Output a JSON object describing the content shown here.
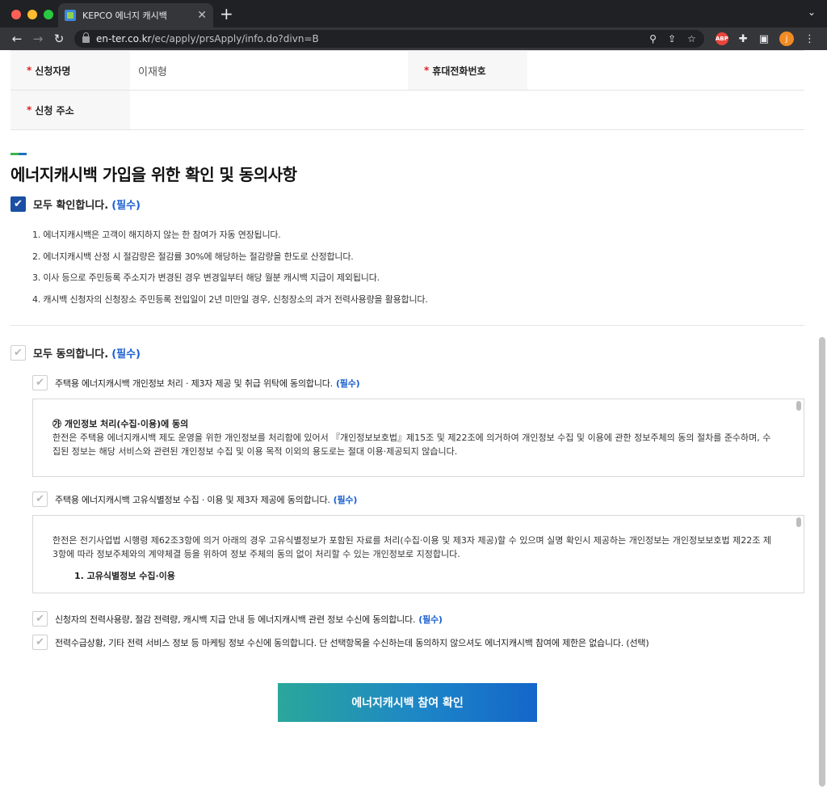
{
  "browser": {
    "tab_title": "KEPCO 에너지 캐시백",
    "tab_close": "✕",
    "new_tab": "+",
    "url_host": "en-ter.co.kr",
    "url_path": "/ec/apply/prsApply/info.do?divn=B",
    "back": "←",
    "forward": "→",
    "reload": "↻",
    "abp_label": "ABP",
    "avatar_letter": "j",
    "tab_menu": "⌄"
  },
  "applicant": {
    "name_label": "신청자명",
    "name_value": "이재형",
    "phone_label": "휴대전화번호",
    "phone_value": "",
    "address_label": "신청 주소",
    "address_value": "",
    "required_mark": "*"
  },
  "section": {
    "title": "에너지캐시백 가입을 위한 확인 및 동의사항"
  },
  "confirm_all": {
    "label": "모두 확인합니다.",
    "tag": "(필수)",
    "checked": true
  },
  "notices": [
    "1. 에너지캐시백은 고객이 해지하지 않는 한 참여가 자동 연장됩니다.",
    "2. 에너지캐시백 산정 시 절감량은 절감률 30%에 해당하는 절감량을 한도로 산정합니다.",
    "3. 이사 등으로 주민등록 주소지가 변경된 경우 변경일부터 해당 월분 캐시백 지급이 제외됩니다.",
    "4. 캐시백 신청자의 신청장소 주민등록 전입일이 2년 미만일 경우, 신청장소의 과거 전력사용량을 활용합니다."
  ],
  "agree_all": {
    "label": "모두 동의합니다.",
    "tag": "(필수)",
    "checked": false
  },
  "consents": [
    {
      "label": "주택용 에너지캐시백 개인정보 처리 · 제3자 제공 및 취급 위탁에 동의합니다.",
      "tag": "(필수)",
      "box_heading": "㉮ 개인정보 처리(수집·이용)에 동의",
      "box_text": "한전은 주택용 에너지캐시백 제도 운영을 위한 개인정보를 처리함에 있어서 『개인정보보호법』제15조 및 제22조에 의거하여 개인정보 수집 및 이용에 관한 정보주체의 동의 절차를 준수하며, 수집된 정보는 해당 서비스와 관련된 개인정보 수집 및 이용 목적 이외의 용도로는 절대 이용·제공되지 않습니다."
    },
    {
      "label": "주택용 에너지캐시백 고유식별정보 수집 · 이용 및 제3자 제공에 동의합니다.",
      "tag": "(필수)",
      "box_text": "한전은 전기사업법 시행령 제62조3항에 의거 아래의 경우 고유식별정보가 포함된 자료를 처리(수집·이용 및 제3자 제공)할 수 있으며 실명 확인시 제공하는 개인정보는 개인정보보호법 제22조 제3항에 따라 정보주체와의 계약체결 등을 위하여 정보 주체의 동의 없이 처리할 수 있는 개인정보로 지정합니다.",
      "box_subheading": "1. 고유식별정보 수집·이용"
    },
    {
      "label": "신청자의 전력사용량, 절감 전력량, 캐시백 지급 안내 등 에너지캐시백 관련 정보 수신에 동의합니다.",
      "tag": "(필수)"
    },
    {
      "label": "전력수급상황, 기타 전력 서비스 정보 등 마케팅 정보 수신에 동의합니다. 단 선택항목을 수신하는데 동의하지 않으셔도 에너지캐시백 참여에 제한은 없습니다. (선택)",
      "tag": ""
    }
  ],
  "submit_label": "에너지캐시백 참여 확인",
  "check_glyph": "✔"
}
